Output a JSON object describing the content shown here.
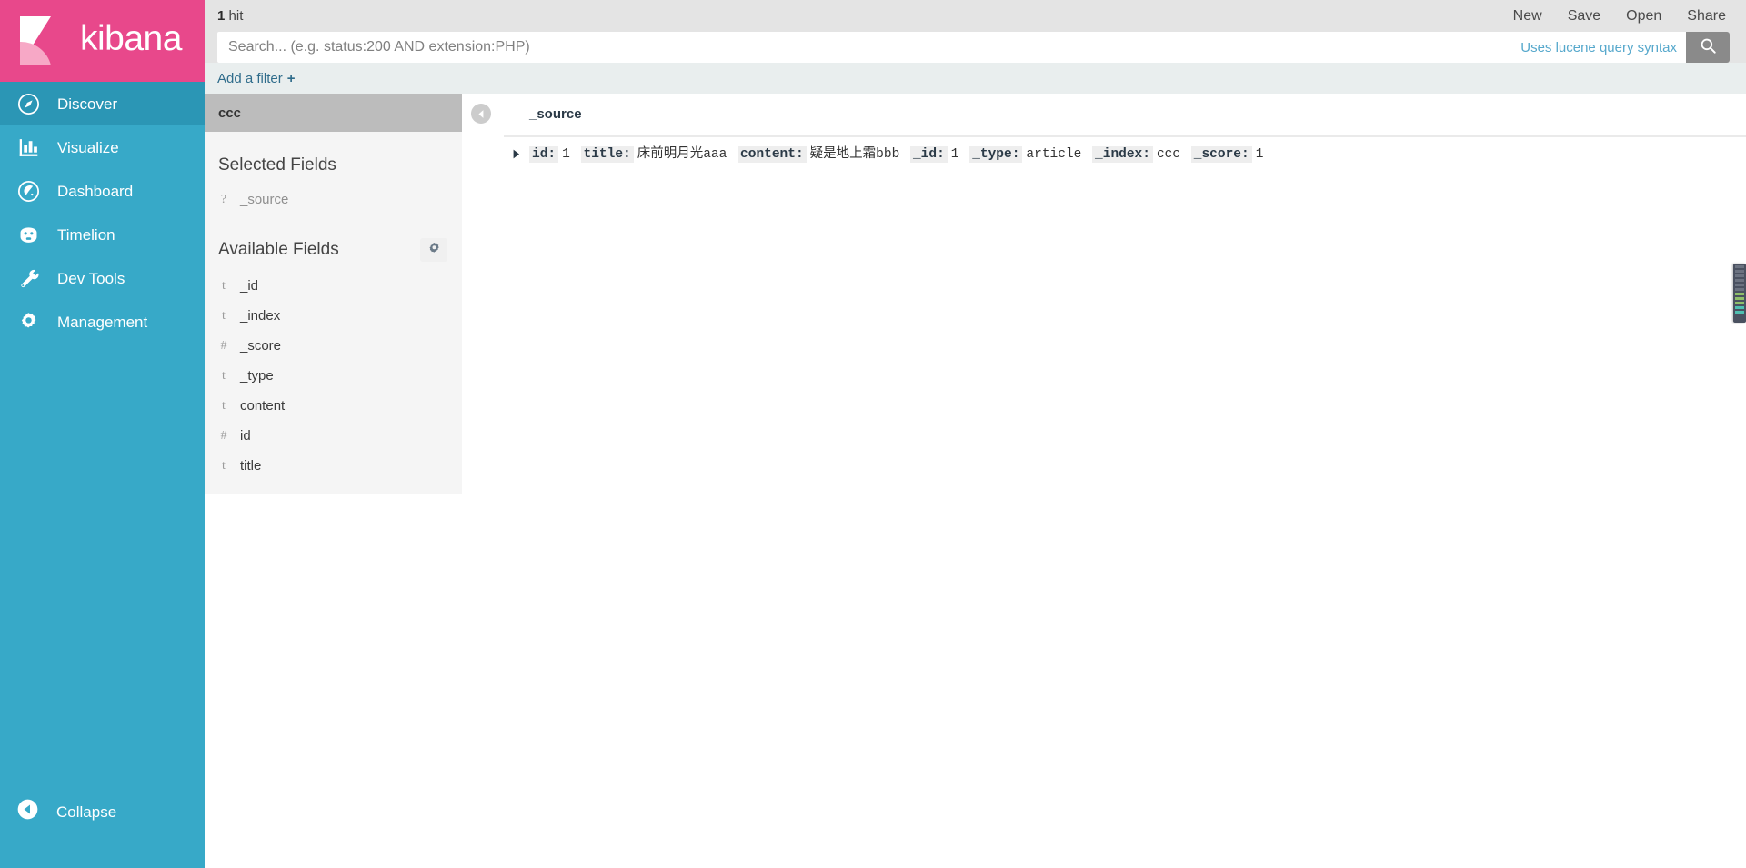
{
  "brand": {
    "name": "kibana",
    "logo_icon": "kibana-logo-icon",
    "logo_bg": "#e8488b",
    "nav_bg": "#37a9c8",
    "nav_active_bg": "#2b96b5"
  },
  "sidebar": {
    "items": [
      {
        "label": "Discover",
        "icon": "compass-icon",
        "active": true
      },
      {
        "label": "Visualize",
        "icon": "bar-chart-icon",
        "active": false
      },
      {
        "label": "Dashboard",
        "icon": "dashboard-gauge-icon",
        "active": false
      },
      {
        "label": "Timelion",
        "icon": "timelion-icon",
        "active": false
      },
      {
        "label": "Dev Tools",
        "icon": "wrench-icon",
        "active": false
      },
      {
        "label": "Management",
        "icon": "gear-icon",
        "active": false
      }
    ],
    "collapse": {
      "label": "Collapse",
      "icon": "arrow-left-circle-icon"
    }
  },
  "header": {
    "hit_count": "1",
    "hit_label": "hit",
    "actions": [
      "New",
      "Save",
      "Open",
      "Share"
    ]
  },
  "search": {
    "value": "",
    "placeholder": "Search... (e.g. status:200 AND extension:PHP)",
    "hint_link": "Uses lucene query syntax",
    "hint_link_color": "#56a8cc",
    "submit_icon": "search-icon"
  },
  "filters": {
    "add_label": "Add a filter",
    "add_plus": "+"
  },
  "fields_panel": {
    "index_pattern": "ccc",
    "selected_heading": "Selected Fields",
    "selected_fields": [
      {
        "name": "_source",
        "type_glyph": "?",
        "muted": true
      }
    ],
    "available_heading": "Available Fields",
    "settings_icon": "gear-icon",
    "available_fields": [
      {
        "name": "_id",
        "type_glyph": "t",
        "muted": false
      },
      {
        "name": "_index",
        "type_glyph": "t",
        "muted": false
      },
      {
        "name": "_score",
        "type_glyph": "#",
        "muted": false
      },
      {
        "name": "_type",
        "type_glyph": "t",
        "muted": false
      },
      {
        "name": "content",
        "type_glyph": "t",
        "muted": false
      },
      {
        "name": "id",
        "type_glyph": "#",
        "muted": false
      },
      {
        "name": "title",
        "type_glyph": "t",
        "muted": false
      }
    ]
  },
  "doc_table": {
    "collapse_icon": "chevron-left-circle-icon",
    "columns": [
      "_source"
    ],
    "rows": [
      {
        "expand_icon": "caret-right-icon",
        "source_pairs": [
          {
            "key": "id:",
            "value": "1"
          },
          {
            "key": "title:",
            "value": "床前明月光aaa"
          },
          {
            "key": "content:",
            "value": "疑是地上霜bbb"
          },
          {
            "key": "_id:",
            "value": "1"
          },
          {
            "key": "_type:",
            "value": "article"
          },
          {
            "key": "_index:",
            "value": "ccc"
          },
          {
            "key": "_score:",
            "value": "1"
          }
        ]
      }
    ]
  },
  "scrollbar": {
    "name": "page-minimap-scrollbar"
  }
}
